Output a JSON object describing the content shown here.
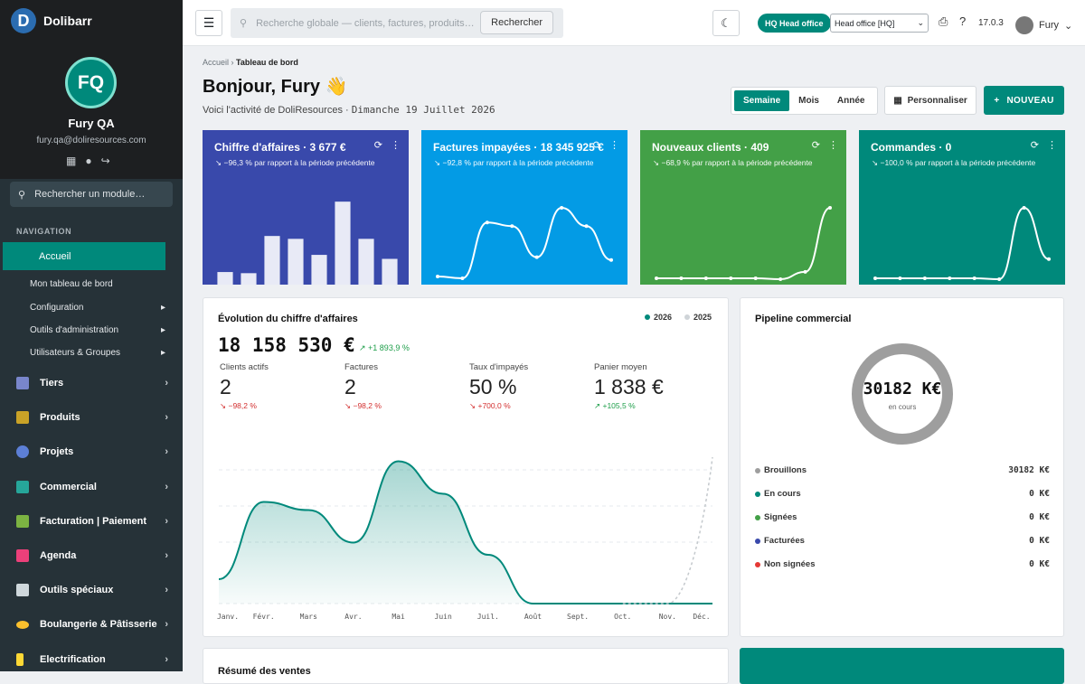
{
  "brand": {
    "logo": "D",
    "name": "Dolibarr"
  },
  "user": {
    "initials": "FQ",
    "name": "Fury QA",
    "email": "fury.qa@doliresources.com"
  },
  "sidebar": {
    "search_placeholder": "Rechercher un module…",
    "nav_heading": "NAVIGATION",
    "active_item": "Accueil",
    "sub_items": [
      "Mon tableau de bord",
      "Configuration",
      "Outils d'administration",
      "Utilisateurs & Groupes"
    ],
    "modules": [
      "Tiers",
      "Produits",
      "Projets",
      "Commercial",
      "Facturation | Paiement",
      "Agenda",
      "Outils spéciaux",
      "Boulangerie & Pâtisserie",
      "Electrification"
    ]
  },
  "topbar": {
    "search_placeholder": "Recherche globale — clients, factures, produits…",
    "search_button": "Rechercher",
    "entity_badge": "HQ Head office",
    "entity_select": "Head office [HQ]",
    "version": "17.0.3",
    "user": "Fury"
  },
  "breadcrumb": {
    "home": "Accueil",
    "current": "Tableau de bord"
  },
  "header": {
    "greeting": "Bonjour, Fury 👋",
    "subtitle": "Voici l'activité de DoliResources · ",
    "date": "Dimanche 19 Juillet 2026"
  },
  "period": {
    "options": [
      "Semaine",
      "Mois",
      "Année"
    ],
    "selected": "Semaine"
  },
  "actions": {
    "customize": "Personnaliser",
    "new": "NOUVEAU"
  },
  "kpis": [
    {
      "title": "Chiffre d'affaires · 3 677 €",
      "delta": "↘ −96,3 % par rapport à la période précédente",
      "color": "#3949ab",
      "chart": "bar",
      "values": [
        2.2,
        2.0,
        8.5,
        8.0,
        5.2,
        14.5,
        8.0,
        4.5
      ]
    },
    {
      "title": "Factures impayées · 18 345 925 €",
      "delta": "↘ −92,8 % par rapport à la période précédente",
      "color": "#039be5",
      "chart": "line",
      "values": [
        0.5,
        0.3,
        6.4,
        6.0,
        2.6,
        8.0,
        6.0,
        2.3
      ]
    },
    {
      "title": "Nouveaux clients · 409",
      "delta": "↘ −68,9 % par rapport à la période précédente",
      "color": "#43a047",
      "chart": "line",
      "values": [
        0.3,
        0.3,
        0.3,
        0.3,
        0.3,
        0.2,
        1.0,
        8.0
      ]
    },
    {
      "title": "Commandes · 0",
      "delta": "↘ −100,0 % par rapport à la période précédente",
      "color": "#00897b",
      "chart": "line",
      "values": [
        0.3,
        0.3,
        0.3,
        0.3,
        0.3,
        0.2,
        8.0,
        2.4
      ]
    }
  ],
  "revenue": {
    "title": "Évolution du chiffre d'affaires",
    "legend": [
      "2026",
      "2025"
    ],
    "legend_colors": [
      "#00897b",
      "#cfd4d8"
    ],
    "total": "18 158 530 €",
    "total_delta": "↗ +1 893,9 %",
    "stats": [
      {
        "label": "Clients actifs",
        "value": "2",
        "delta": "↘ −98,2 %",
        "trend": "down"
      },
      {
        "label": "Factures",
        "value": "2",
        "delta": "↘ −98,2 %",
        "trend": "down"
      },
      {
        "label": "Taux d'impayés",
        "value": "50 %",
        "delta": "↘ +700,0 %",
        "trend": "down"
      },
      {
        "label": "Panier moyen",
        "value": "1 838 €",
        "delta": "↗ +105,5 %",
        "trend": "up"
      }
    ]
  },
  "chart_data": {
    "type": "area",
    "categories": [
      "Janv.",
      "Févr.",
      "Mars",
      "Avr.",
      "Mai",
      "Juin",
      "Juil.",
      "Août",
      "Sept.",
      "Oct.",
      "Nov.",
      "Déc."
    ],
    "series": [
      {
        "name": "2026",
        "values": [
          1.2,
          5.0,
          4.6,
          3.0,
          7.0,
          5.4,
          2.4,
          0.0,
          0.0,
          0.0,
          0.0,
          0.0
        ]
      },
      {
        "name": "2025",
        "values": [
          0,
          0,
          0,
          0,
          0,
          0,
          0,
          0,
          0,
          0,
          0,
          7.2
        ]
      }
    ],
    "title": "Évolution du chiffre d'affaires",
    "ylim": [
      0,
      8
    ]
  },
  "pipeline": {
    "title": "Pipeline commercial",
    "center_value": "30182 K€",
    "center_label": "en cours",
    "items": [
      {
        "label": "Brouillons",
        "value": "30182 K€",
        "color": "#9e9e9e"
      },
      {
        "label": "En cours",
        "value": "0 K€",
        "color": "#00897b"
      },
      {
        "label": "Signées",
        "value": "0 K€",
        "color": "#43a047"
      },
      {
        "label": "Facturées",
        "value": "0 K€",
        "color": "#3949ab"
      },
      {
        "label": "Non signées",
        "value": "0 K€",
        "color": "#e53935"
      }
    ]
  },
  "sales_summary": {
    "title": "Résumé des ventes"
  }
}
